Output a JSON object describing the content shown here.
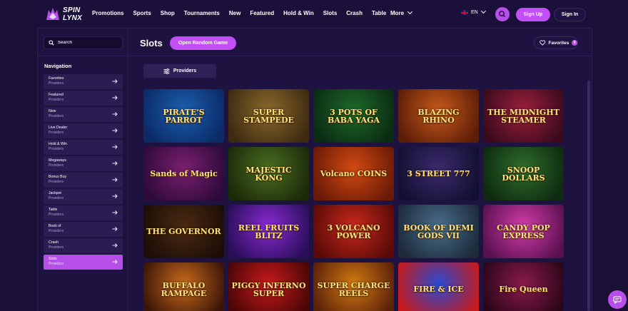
{
  "header": {
    "logo_line1": "SPIN",
    "logo_line2": "LYNX",
    "nav": [
      "Promotions",
      "Sports",
      "Shop",
      "Tournaments",
      "New",
      "Featured",
      "Hold & Win",
      "Slots",
      "Crash",
      "Table"
    ],
    "more_label": "More",
    "language": "EN",
    "signup_label": "Sign Up",
    "signin_label": "Sign In"
  },
  "sidebar": {
    "search_placeholder": "Search",
    "nav_title": "Navigation",
    "items": [
      {
        "label": "Favorites",
        "sub": "Providers"
      },
      {
        "label": "Featured",
        "sub": "Providers"
      },
      {
        "label": "New",
        "sub": "Providers"
      },
      {
        "label": "Live Dealer",
        "sub": "Providers"
      },
      {
        "label": "Hold & Win",
        "sub": "Providers"
      },
      {
        "label": "Megaways",
        "sub": "Providers"
      },
      {
        "label": "Bonus Buy",
        "sub": "Providers"
      },
      {
        "label": "Jackpot",
        "sub": "Providers"
      },
      {
        "label": "Table",
        "sub": "Providers"
      },
      {
        "label": "Book of",
        "sub": "Providers"
      },
      {
        "label": "Crash",
        "sub": "Providers"
      },
      {
        "label": "Slots",
        "sub": "Providers"
      }
    ],
    "active_index": 11
  },
  "main": {
    "title": "Slots",
    "random_label": "Open Random Game",
    "favorites_label": "Favorites",
    "favorites_count": "0",
    "providers_label": "Providers"
  },
  "games": [
    {
      "title": "PIRATE'S PARROT",
      "bg": "#1b5fae",
      "bg2": "#0b2a66"
    },
    {
      "title": "SUPER STAMPEDE",
      "bg": "#8a6a2c",
      "bg2": "#3d2a10"
    },
    {
      "title": "3 POTS OF BABA YAGA",
      "bg": "#1f6b2a",
      "bg2": "#0a2a12"
    },
    {
      "title": "BLAZING RHINO",
      "bg": "#c85a1a",
      "bg2": "#5c1d08"
    },
    {
      "title": "THE MIDNIGHT STEAMER",
      "bg": "#9c1f3c",
      "bg2": "#3a0a1c"
    },
    {
      "title": "Sands of Magic",
      "bg": "#7a1f6e",
      "bg2": "#2e0a3a"
    },
    {
      "title": "MAJESTIC KONG",
      "bg": "#4a6e1f",
      "bg2": "#1c2a0a"
    },
    {
      "title": "Volcano COINS",
      "bg": "#d24a12",
      "bg2": "#6a1a06"
    },
    {
      "title": "3 STREET 777",
      "bg": "#3c2a6e",
      "bg2": "#121030"
    },
    {
      "title": "SNOOP DOLLARS",
      "bg": "#2f6e2a",
      "bg2": "#0e2a10"
    },
    {
      "title": "THE GOVERNOR",
      "bg": "#4a2a12",
      "bg2": "#1c0e06"
    },
    {
      "title": "REEL FRUITS BLITZ",
      "bg": "#8a2ad2",
      "bg2": "#2a0e5a"
    },
    {
      "title": "3 VOLCANO POWER",
      "bg": "#c8281a",
      "bg2": "#5a0a08"
    },
    {
      "title": "BOOK OF DEMI GODS VII",
      "bg": "#4a6e8c",
      "bg2": "#1c2a3a"
    },
    {
      "title": "CANDY POP EXPRESS",
      "bg": "#d23ca8",
      "bg2": "#5a1050"
    },
    {
      "title": "BUFFALO RAMPAGE",
      "bg": "#c86a1a",
      "bg2": "#3a1408"
    },
    {
      "title": "PIGGY INFERNO SUPER",
      "bg": "#c81a1a",
      "bg2": "#4a0606"
    },
    {
      "title": "SUPER CHARGE REELS",
      "bg": "#d27a12",
      "bg2": "#5a2008"
    },
    {
      "title": "FIRE & ICE",
      "bg": "#2a4ad2",
      "bg2": "#c81a1a"
    },
    {
      "title": "Fire Queen",
      "bg": "#8a1a4a",
      "bg2": "#2a0618"
    }
  ]
}
